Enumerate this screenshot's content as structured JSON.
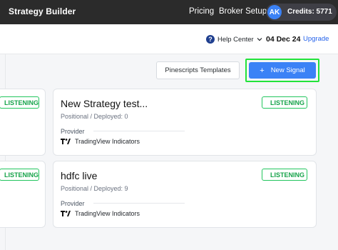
{
  "header": {
    "brand": "Strategy Builder",
    "nav": {
      "pricing": "Pricing",
      "broker_setup": "Broker Setup"
    },
    "avatar_initials": "AK",
    "credits": "Credits: 5771"
  },
  "subheader": {
    "help_label": "Help Center",
    "date": "04 Dec 24",
    "upgrade_label": "Upgrade"
  },
  "actions": {
    "templates_label": "Pinescripts Templates",
    "new_signal_plus": "+",
    "new_signal_label": "New Signal"
  },
  "strategies": [
    {
      "title": "New Strategy test...",
      "meta": "Positional / Deployed: 0",
      "status": "LISTENING",
      "provider_label": "Provider",
      "provider_name": "TradingView Indicators"
    },
    {
      "title": "hdfc live",
      "meta": "Positional / Deployed: 9",
      "status": "LISTENING",
      "provider_label": "Provider",
      "provider_name": "TradingView Indicators"
    }
  ],
  "left_cards": [
    {
      "status": "LISTENING"
    },
    {
      "status": "LISTENING"
    }
  ],
  "colors": {
    "topbar": "#2b2b2b",
    "accent": "#3b82f6",
    "listening": "#22c55e",
    "highlight": "#22e33a"
  },
  "icons": {
    "help": "question-circle-icon",
    "chevron": "chevron-down-icon",
    "provider": "tradingview-logo-icon"
  }
}
